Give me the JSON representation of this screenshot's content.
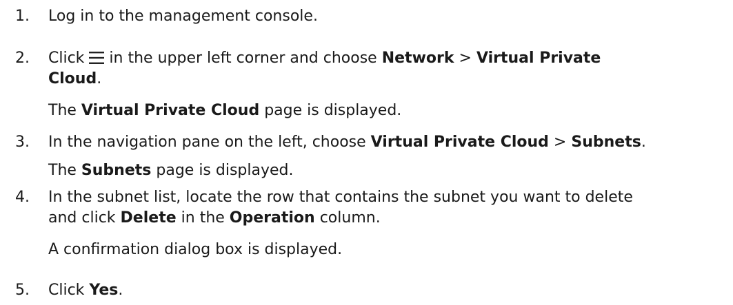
{
  "steps": [
    {
      "number": "1.",
      "text": "Log in to the management console."
    },
    {
      "number": "2.",
      "pre": "Click",
      "icon": "hamburger-menu-icon",
      "mid": "in the upper left corner and choose",
      "bold1": "Network",
      "sep": ">",
      "bold2a": "Virtual Private",
      "bold2b": "Cloud",
      "end": ".",
      "result_bold": "Virtual Private Cloud",
      "result_prefix": "The",
      "result_suffix": "page is displayed."
    },
    {
      "number": "3.",
      "pre": "In the navigation pane on the left, choose",
      "bold1": "Virtual Private Cloud",
      "sep": ">",
      "bold2": "Subnets",
      "end": ".",
      "result_prefix": "The",
      "result_bold": "Subnets",
      "result_suffix": "page is displayed."
    },
    {
      "number": "4.",
      "line1": "In the subnet list, locate the row that contains the subnet you want to delete",
      "pre2": "and click",
      "bold1": "Delete",
      "mid": "in the",
      "bold2": "Operation",
      "end": "column.",
      "result": "A confirmation dialog box is displayed."
    },
    {
      "number": "5.",
      "pre": "Click",
      "bold1": "Yes",
      "end": "."
    }
  ]
}
